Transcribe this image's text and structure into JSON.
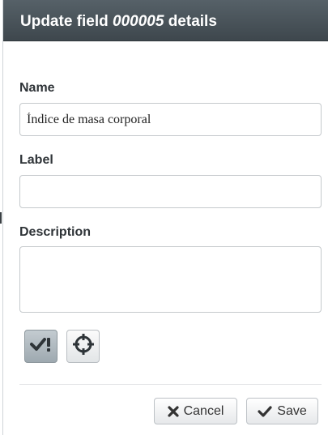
{
  "dialog": {
    "title_prefix": "Update field",
    "title_id": "000005",
    "title_suffix": "details"
  },
  "form": {
    "name_label": "Name",
    "name_value": "Índice de masa corporal",
    "label_label": "Label",
    "label_value": "",
    "description_label": "Description",
    "description_value": ""
  },
  "tools": {
    "validate_icon": "check-exclamation-icon",
    "target_icon": "crosshair-icon"
  },
  "footer": {
    "cancel_label": "Cancel",
    "save_label": "Save"
  }
}
